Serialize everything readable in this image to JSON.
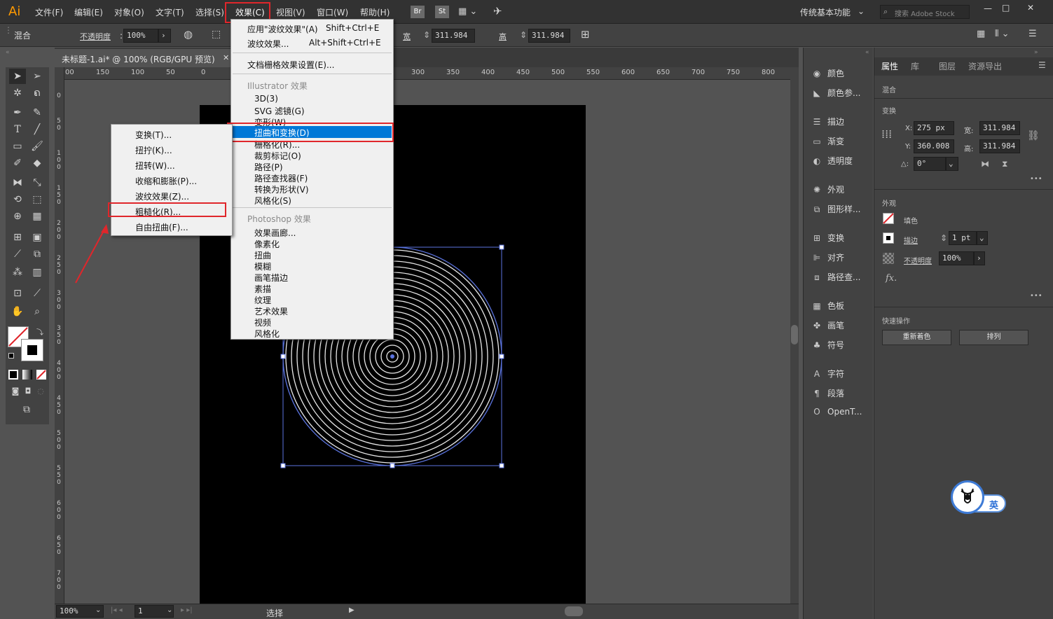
{
  "app": {
    "logo": "Ai"
  },
  "menubar": {
    "items": [
      "文件(F)",
      "编辑(E)",
      "对象(O)",
      "文字(T)",
      "选择(S)",
      "效果(C)",
      "视图(V)",
      "窗口(W)",
      "帮助(H)"
    ],
    "bridge": "Br",
    "stock": "St",
    "workspace": "传统基本功能",
    "search_placeholder": "搜索 Adobe Stock",
    "win_min": "—",
    "win_max": "□",
    "win_close": "✕"
  },
  "controlbar": {
    "mode": "混合",
    "opacity_label": "不透明度",
    "opacity_value": "100%",
    "w_label": "宽",
    "w_value": "311.984",
    "h_label": "高",
    "h_value": "311.984"
  },
  "document": {
    "tab_title": "未标题-1.ai* @ 100% (RGB/GPU 预览)",
    "close": "✕",
    "ruler_ticks": [
      "00",
      "150",
      "100",
      "50",
      "0",
      "300",
      "350",
      "400",
      "450",
      "500",
      "550",
      "600",
      "650",
      "700",
      "750",
      "800"
    ],
    "vruler_ticks": [
      "0",
      "5 0",
      "1 0 0",
      "1 5 0",
      "2 0 0",
      "2 5 0",
      "3 0 0",
      "3 5 0",
      "4 0 0",
      "4 5 0",
      "5 0 0",
      "5 5 0",
      "6 0 0",
      "6 5 0",
      "7 0 0",
      "7 5 0"
    ]
  },
  "statusbar": {
    "zoom": "100%",
    "page": "1",
    "tool": "选择"
  },
  "effect_menu": {
    "title": "效果(C)",
    "apply_last": "应用\"波纹效果\"(A)",
    "apply_last_shortcut": "Shift+Ctrl+E",
    "last_effect": "波纹效果...",
    "last_effect_shortcut": "Alt+Shift+Ctrl+E",
    "doc_raster": "文档栅格效果设置(E)...",
    "illustrator_header": "Illustrator 效果",
    "illustrator_items": [
      "3D(3)",
      "SVG 滤镜(G)",
      "变形(W)",
      "扭曲和变换(D)",
      "栅格化(R)...",
      "裁剪标记(O)",
      "路径(P)",
      "路径查找器(F)",
      "转换为形状(V)",
      "风格化(S)"
    ],
    "photoshop_header": "Photoshop 效果",
    "photoshop_items": [
      "效果画廊...",
      "像素化",
      "扭曲",
      "模糊",
      "画笔描边",
      "素描",
      "纹理",
      "艺术效果",
      "视频",
      "风格化"
    ]
  },
  "distort_submenu": {
    "items": [
      "变换(T)...",
      "扭拧(K)...",
      "扭转(W)...",
      "收缩和膨胀(P)...",
      "波纹效果(Z)...",
      "粗糙化(R)...",
      "自由扭曲(F)..."
    ]
  },
  "dock": {
    "items": [
      "颜色",
      "颜色参...",
      "描边",
      "渐变",
      "透明度",
      "外观",
      "图形样...",
      "变换",
      "对齐",
      "路径查...",
      "色板",
      "画笔",
      "符号",
      "字符",
      "段落",
      "OpenT..."
    ]
  },
  "properties": {
    "tabs": [
      "属性",
      "库",
      "图层",
      "资源导出"
    ],
    "mix": "混合",
    "transform_title": "变换",
    "x_label": "X:",
    "x_value": "275 px",
    "y_label": "Y:",
    "y_value": "360.008",
    "w_label": "宽:",
    "w_value": "311.984",
    "h_label": "高:",
    "h_value": "311.984",
    "angle_label": "△:",
    "angle_value": "0°",
    "appearance_title": "外观",
    "fill_label": "填色",
    "stroke_label": "描边",
    "stroke_value": "1 pt",
    "opacity_label": "不透明度",
    "opacity_value": "100%",
    "fx": "fx.",
    "quick_title": "快速操作",
    "recolor_btn": "重新着色",
    "arrange_btn": "排列",
    "more": "•••"
  },
  "badge": {
    "text": "英"
  }
}
